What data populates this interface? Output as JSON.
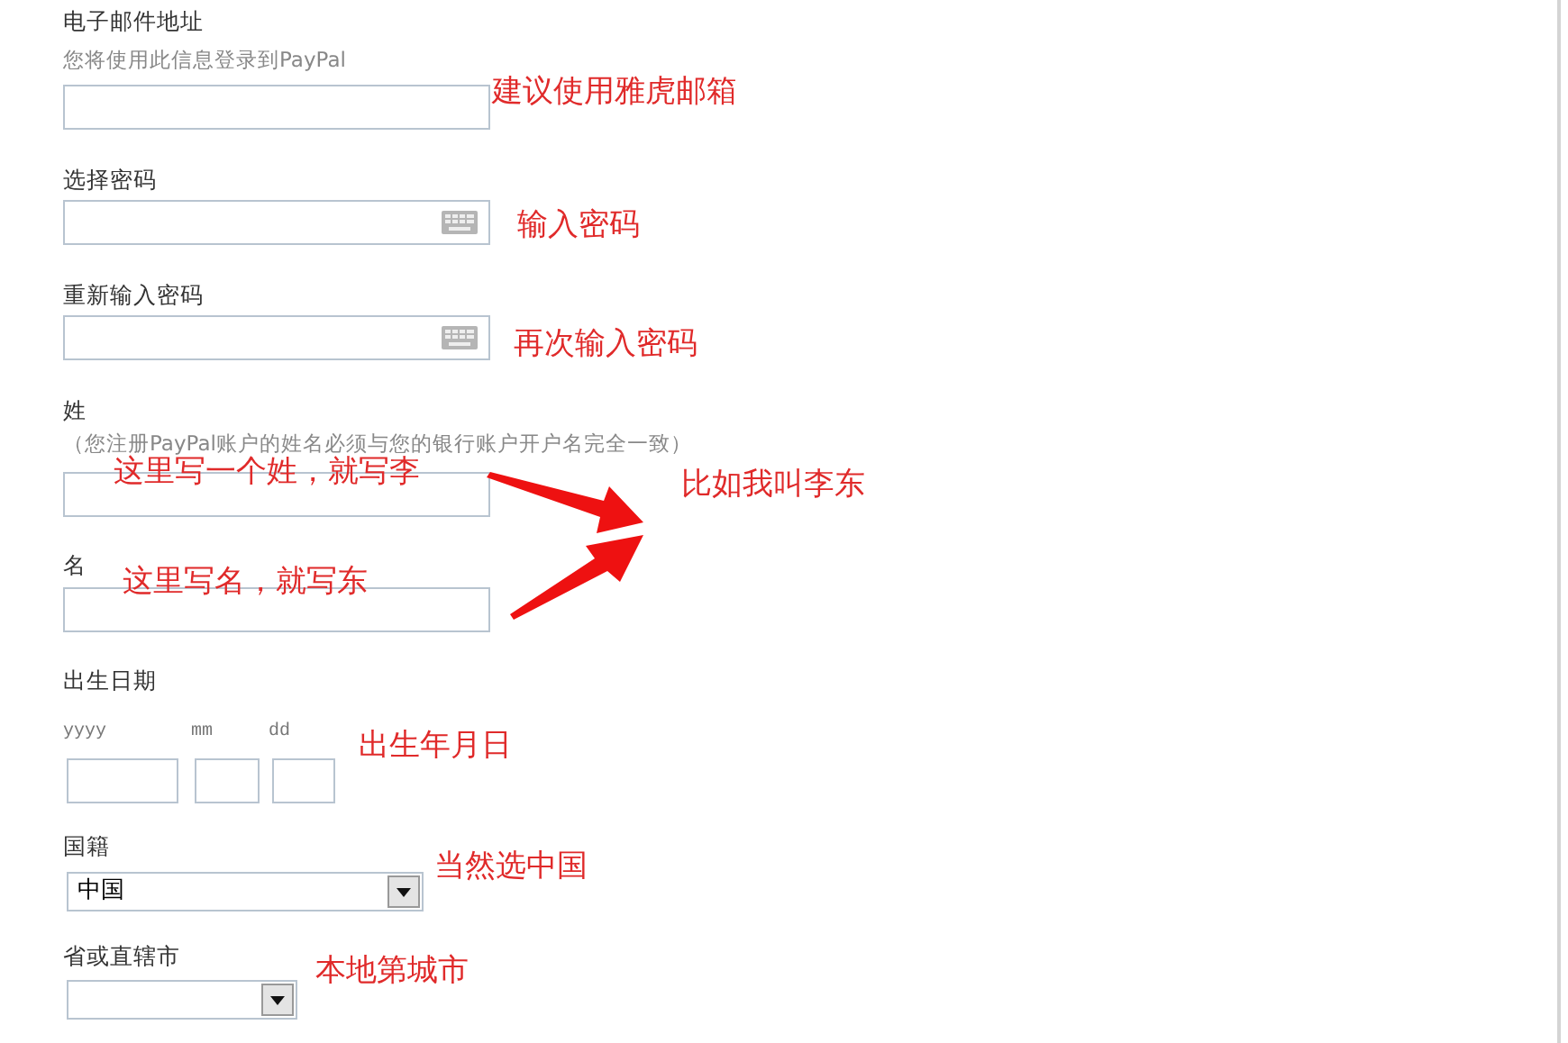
{
  "fields": [
    {
      "kind": "text",
      "label": "电子邮件地址",
      "hint": "您将使用此信息登录到PayPal"
    },
    {
      "kind": "password",
      "label": "选择密码"
    },
    {
      "kind": "password",
      "label": "重新输入密码"
    },
    {
      "kind": "text",
      "label": "姓",
      "hint": "（您注册PayPal账户的姓名必须与您的银行账户开户名完全一致）"
    },
    {
      "kind": "text",
      "label": "名"
    },
    {
      "kind": "date",
      "label": "出生日期",
      "parts": [
        "yyyy",
        "mm",
        "dd"
      ]
    },
    {
      "kind": "select",
      "label": "国籍",
      "value": "中国"
    },
    {
      "kind": "select",
      "label": "省或直辖市"
    }
  ],
  "annotations": [
    {
      "text": "建议使用雅虎邮箱"
    },
    {
      "text": "输入密码"
    },
    {
      "text": "再次输入密码"
    },
    {
      "text": "这里写一个姓，就写李"
    },
    {
      "text": "比如我叫李东"
    },
    {
      "text": "这里写名，就写东"
    },
    {
      "text": "出生年月日"
    },
    {
      "text": "当然选中国"
    },
    {
      "text": "本地第城市"
    }
  ]
}
